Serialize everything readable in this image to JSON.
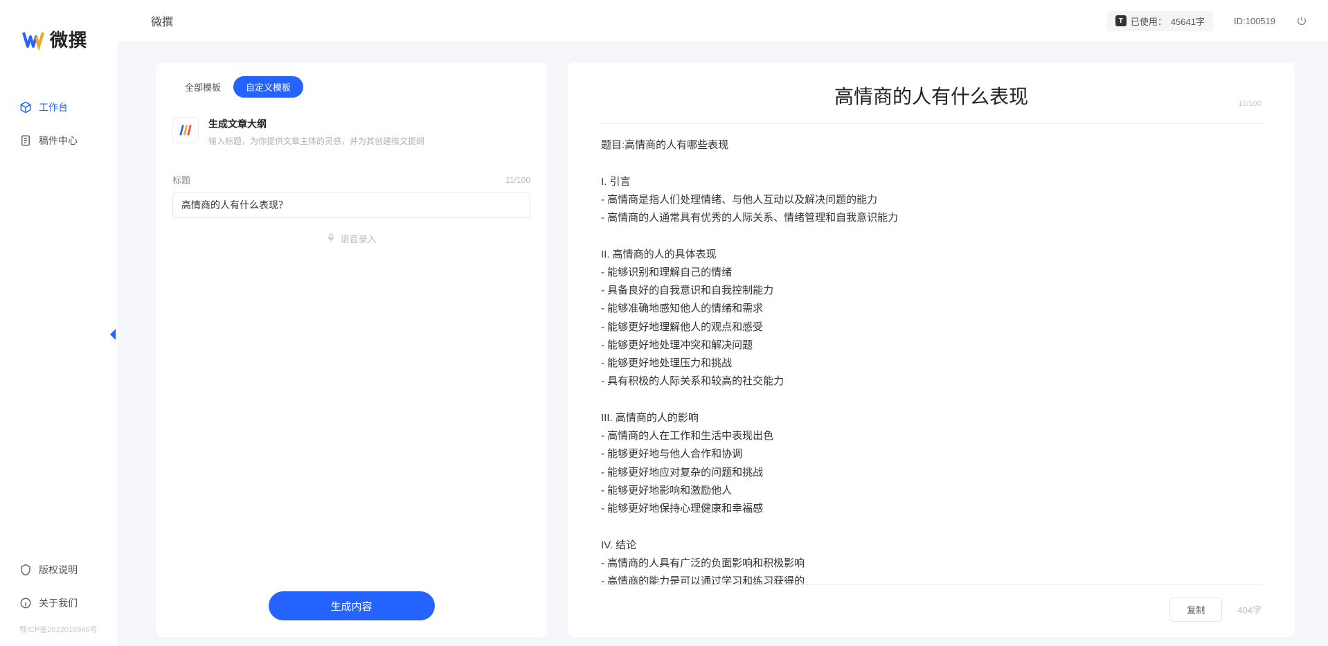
{
  "app": {
    "name": "微撰",
    "topbar_title": "微撰",
    "usage_label": "已使用：",
    "usage_value": "45641字",
    "user_id_label": "ID:100519"
  },
  "sidebar": {
    "items": [
      {
        "label": "工作台",
        "icon": "cube-icon",
        "active": true
      },
      {
        "label": "稿件中心",
        "icon": "document-icon",
        "active": false
      }
    ],
    "bottom": [
      {
        "label": "版权说明",
        "icon": "shield-icon"
      },
      {
        "label": "关于我们",
        "icon": "info-icon"
      }
    ],
    "icp": "鄂ICP备2022016946号"
  },
  "left_panel": {
    "tabs": [
      {
        "label": "全部模板",
        "active": false
      },
      {
        "label": "自定义模板",
        "active": true
      }
    ],
    "template": {
      "title": "生成文章大纲",
      "desc": "输入标题，为你提供文章主体的灵感，并为其创建推文提纲"
    },
    "field_label": "标题",
    "field_count": "11/100",
    "input_value": "高情商的人有什么表现？",
    "voice_label": "语音录入",
    "generate_label": "生成内容"
  },
  "right_panel": {
    "title": "高情商的人有什么表现",
    "title_count": "10/100",
    "body": "题目:高情商的人有哪些表现\n\nI. 引言\n- 高情商是指人们处理情绪、与他人互动以及解决问题的能力\n- 高情商的人通常具有优秀的人际关系、情绪管理和自我意识能力\n\nII. 高情商的人的具体表现\n- 能够识别和理解自己的情绪\n- 具备良好的自我意识和自我控制能力\n- 能够准确地感知他人的情绪和需求\n- 能够更好地理解他人的观点和感受\n- 能够更好地处理冲突和解决问题\n- 能够更好地处理压力和挑战\n- 具有积极的人际关系和较高的社交能力\n\nIII. 高情商的人的影响\n- 高情商的人在工作和生活中表现出色\n- 能够更好地与他人合作和协调\n- 能够更好地应对复杂的问题和挑战\n- 能够更好地影响和激励他人\n- 能够更好地保持心理健康和幸福感\n\nIV. 结论\n- 高情商的人具有广泛的负面影响和积极影响\n- 高情商的能力是可以通过学习和练习获得的\n- 培养和提高高情商的能力对于个人的职业发展和生活质量至关重要。",
    "copy_label": "复制",
    "word_count": "404字"
  }
}
